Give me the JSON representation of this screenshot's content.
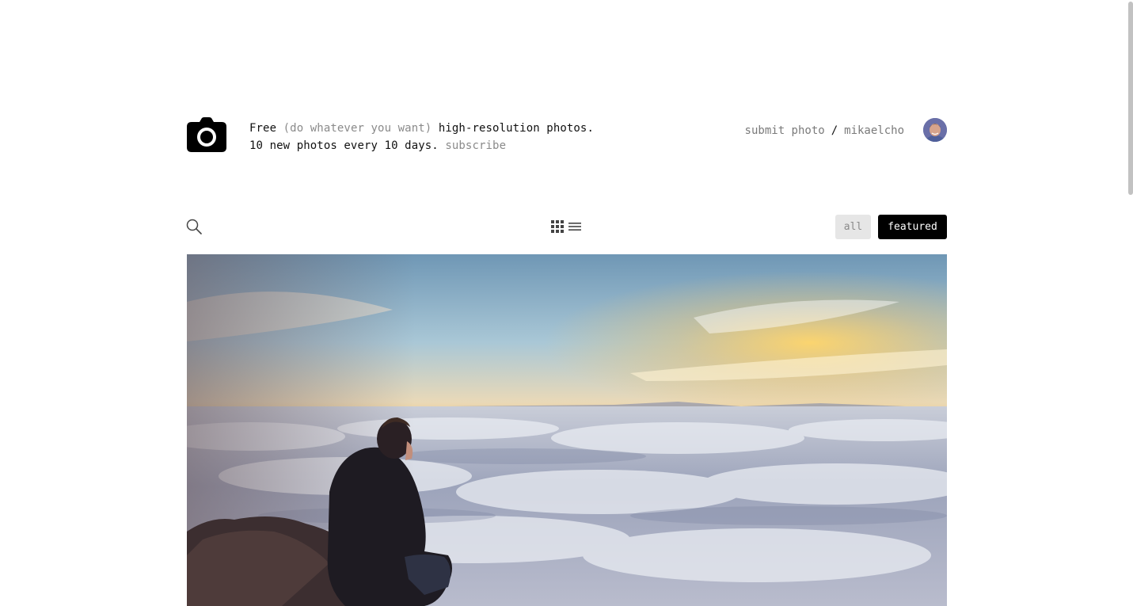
{
  "header": {
    "logo_icon": "camera-icon",
    "tagline": {
      "free": "Free",
      "aside": "(do whatever you want)",
      "rest": "high-resolution photos.",
      "line2": "10 new photos every 10 days.",
      "subscribe": "subscribe"
    },
    "nav": {
      "submit": "submit photo",
      "separator": "/",
      "user": "mikaelcho"
    },
    "avatar_icon": "user-avatar"
  },
  "toolbar": {
    "search_icon": "search-icon",
    "grid_icon": "grid-view-icon",
    "list_icon": "list-view-icon",
    "filters": {
      "all": "all",
      "featured": "featured",
      "active": "featured"
    }
  },
  "photo": {
    "subject": "person-sitting-above-clouds"
  },
  "colors": {
    "accent": "#000000",
    "muted": "#8a8a8a",
    "filter_inactive_bg": "#e6e6e6"
  }
}
